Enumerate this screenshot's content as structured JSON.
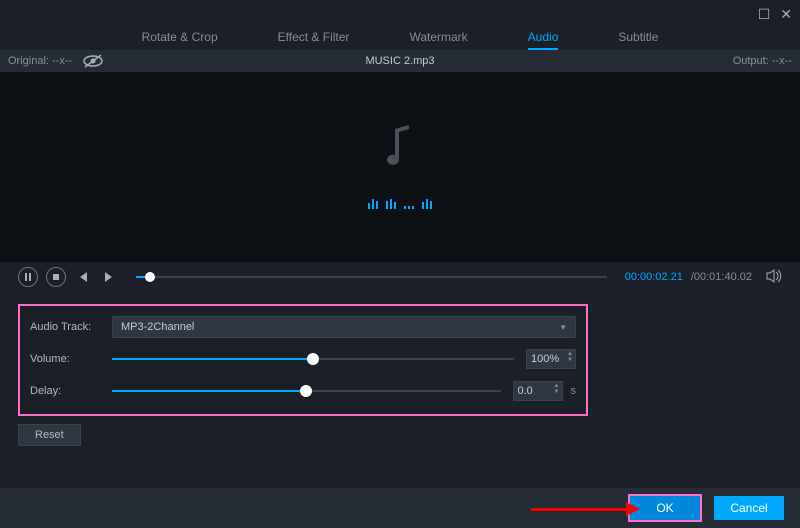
{
  "tabs": {
    "rotate": "Rotate & Crop",
    "effect": "Effect & Filter",
    "watermark": "Watermark",
    "audio": "Audio",
    "subtitle": "Subtitle"
  },
  "info": {
    "original": "Original: --x--",
    "filename": "MUSIC 2.mp3",
    "output": "Output: --x--"
  },
  "playback": {
    "current": "00:00:02.21",
    "total": "/00:01:40.02"
  },
  "audio": {
    "track_label": "Audio Track:",
    "track_value": "MP3-2Channel",
    "volume_label": "Volume:",
    "volume_value": "100%",
    "delay_label": "Delay:",
    "delay_value": "0.0",
    "delay_unit": "s",
    "reset": "Reset"
  },
  "footer": {
    "ok": "OK",
    "cancel": "Cancel"
  },
  "slider": {
    "volume_pct": 50,
    "delay_pct": 50,
    "seek_pct": 3
  }
}
